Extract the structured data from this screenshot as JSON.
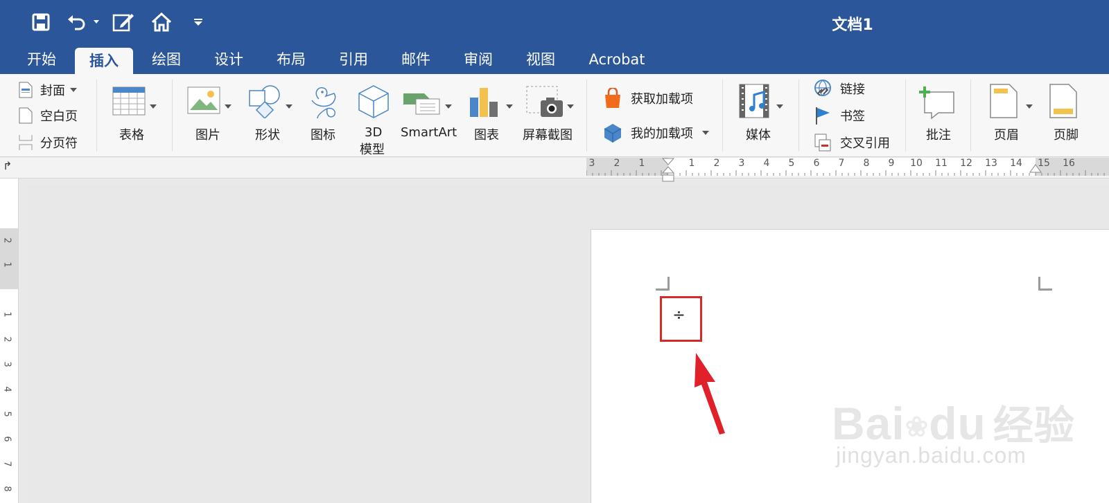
{
  "window": {
    "title": "文档1"
  },
  "quick_access": {
    "save": "save-icon",
    "undo": "undo-icon",
    "edit": "edit-icon",
    "home": "home-icon",
    "customize": "customize-icon"
  },
  "tabs": [
    {
      "label": "开始",
      "active": false
    },
    {
      "label": "插入",
      "active": true
    },
    {
      "label": "绘图",
      "active": false
    },
    {
      "label": "设计",
      "active": false
    },
    {
      "label": "布局",
      "active": false
    },
    {
      "label": "引用",
      "active": false
    },
    {
      "label": "邮件",
      "active": false
    },
    {
      "label": "审阅",
      "active": false
    },
    {
      "label": "视图",
      "active": false
    },
    {
      "label": "Acrobat",
      "active": false
    }
  ],
  "ribbon": {
    "pages": {
      "cover": "封面",
      "blank_page": "空白页",
      "page_break": "分页符"
    },
    "table": "表格",
    "illustrations": {
      "picture": "图片",
      "shapes": "形状",
      "icons": "图标",
      "model_3d_line1": "3D",
      "model_3d_line2": "模型",
      "smartart": "SmartArt",
      "chart": "图表",
      "screenshot": "屏幕截图"
    },
    "addins": {
      "get": "获取加载项",
      "mine": "我的加载项"
    },
    "media": "媒体",
    "links": {
      "link": "链接",
      "bookmark": "书签",
      "cross_ref": "交叉引用"
    },
    "comment": "批注",
    "header": "页眉",
    "footer": "页脚"
  },
  "ruler": {
    "h_numbers": [
      "3",
      "2",
      "1",
      "1",
      "2",
      "3",
      "4",
      "5",
      "6",
      "7",
      "8",
      "9",
      "10",
      "11",
      "12",
      "13",
      "14",
      "15",
      "16"
    ],
    "v_numbers": [
      "2",
      "1",
      "1",
      "2",
      "3",
      "4",
      "5",
      "6",
      "7",
      "8"
    ]
  },
  "document": {
    "symbol": "÷"
  },
  "watermark": {
    "brand": "Bai",
    "brand2": "du",
    "cn": "经验",
    "url": "jingyan.baidu.com"
  },
  "colors": {
    "title_bar": "#2b579a",
    "highlight": "#d42a2a",
    "arrow": "#e0202a"
  }
}
